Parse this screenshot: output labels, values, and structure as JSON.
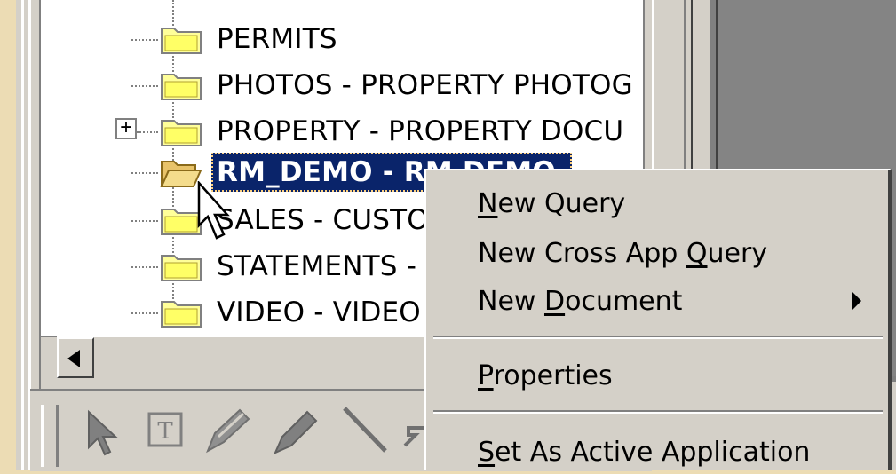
{
  "tree": {
    "items": [
      {
        "label": "PERMITS",
        "state": "closed"
      },
      {
        "label": "PHOTOS - PROPERTY PHOTOG",
        "state": "closed"
      },
      {
        "label": "PROPERTY - PROPERTY DOCU",
        "state": "closed",
        "expander": "+"
      },
      {
        "label": "RM_DEMO - RM DEMO",
        "state": "open",
        "selected": true
      },
      {
        "label": "SALES - CUSTO",
        "state": "closed"
      },
      {
        "label": "STATEMENTS -",
        "state": "closed"
      },
      {
        "label": "VIDEO - VIDEO",
        "state": "closed"
      }
    ]
  },
  "context_menu": {
    "items": [
      {
        "label": "New Query",
        "accel": "N"
      },
      {
        "label": "New Cross App Query",
        "accel": "Q"
      },
      {
        "label": "New Document",
        "accel": "D",
        "submenu": true
      },
      {
        "label": "Properties",
        "accel": "P"
      },
      {
        "label": "Set As Active Application",
        "accel": "S"
      }
    ]
  },
  "toolbar": {
    "tools": [
      "select-arrow-icon",
      "text-tool-icon",
      "pen-tool-icon",
      "highlighter-icon",
      "line-tool-icon",
      "arrow-tool-icon"
    ]
  },
  "colors": {
    "selection": "#0a246a",
    "folder_yellow": "#ffff99",
    "face": "#d4d0c8"
  }
}
